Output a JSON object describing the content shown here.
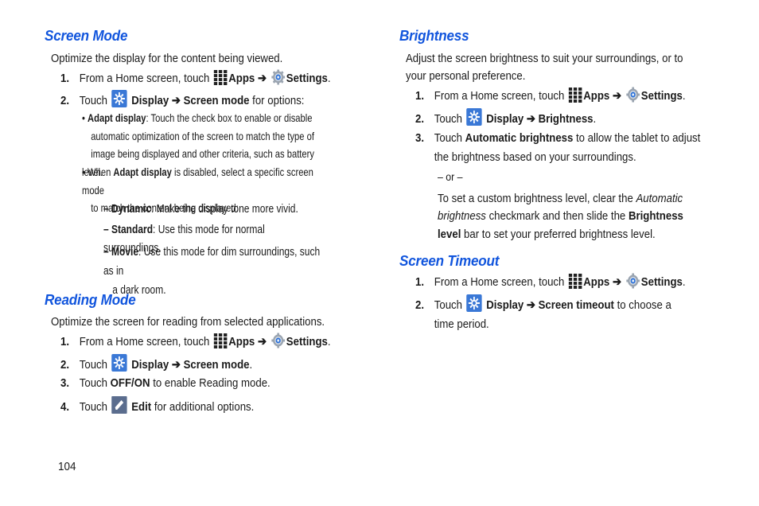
{
  "page_number": "104",
  "arrow": "➔",
  "colors": {
    "heading": "#1155dd",
    "display_icon_bg": "#3a78d6",
    "edit_icon_bg": "#5b6d8e"
  },
  "icons": {
    "apps": "apps-grid-icon",
    "settings": "settings-gear-icon",
    "display": "display-brightness-icon",
    "edit": "edit-pencil-icon"
  },
  "screen_mode": {
    "title": "Screen Mode",
    "intro": "Optimize the display for the content being viewed.",
    "steps": [
      {
        "num": "1.",
        "pre": "From a Home screen, touch",
        "apps": "Apps",
        "settings": "Settings",
        "post": "."
      },
      {
        "num": "2.",
        "pre": "Touch",
        "display": "Display",
        "target": "Screen mode",
        "post": " for options:"
      }
    ],
    "bullets": [
      {
        "bold": "Adapt display",
        "text": ": Touch the check box to enable or disable",
        "lines": [
          "automatic optimization of the screen to match the type of",
          "image being displayed and other criteria, such as battery level."
        ]
      },
      {
        "pre": "When ",
        "bold": "Adapt display",
        "text": " is disabled, select a specific screen mode",
        "lines": [
          "to match the content being displayed:"
        ]
      }
    ],
    "modes": [
      {
        "dash": "–",
        "bold": "Dynamic",
        "text": ": Make the display tone more vivid."
      },
      {
        "dash": "–",
        "bold": "Standard",
        "text": ": Use this mode for normal surroundings."
      },
      {
        "dash": "–",
        "bold": "Movie",
        "text": ": Use this mode for dim surroundings, such as in",
        "line2": "a dark room."
      }
    ]
  },
  "reading_mode": {
    "title": "Reading Mode",
    "intro": "Optimize the screen for reading from selected applications.",
    "steps": [
      {
        "num": "1.",
        "pre": "From a Home screen, touch",
        "apps": "Apps",
        "settings": "Settings",
        "post": "."
      },
      {
        "num": "2.",
        "pre": "Touch",
        "display": "Display",
        "target": "Screen mode",
        "post": "."
      },
      {
        "num": "3.",
        "pre": "Touch ",
        "bold": "OFF/ON",
        "post": " to enable Reading mode."
      },
      {
        "num": "4.",
        "pre": "Touch",
        "bold": "Edit",
        "post": " for additional options."
      }
    ]
  },
  "brightness": {
    "title": "Brightness",
    "intro_line1": "Adjust the screen brightness to suit your surroundings, or to",
    "intro_line2": "your personal preference.",
    "steps": [
      {
        "num": "1.",
        "pre": "From a Home screen, touch",
        "apps": "Apps",
        "settings": "Settings",
        "post": "."
      },
      {
        "num": "2.",
        "pre": "Touch",
        "display": "Display",
        "target": "Brightness",
        "post": "."
      },
      {
        "num": "3.",
        "pre": "Touch ",
        "bold": "Automatic brightness",
        "post": " to allow the tablet to adjust",
        "line2": "the brightness based on your surroundings."
      }
    ],
    "or": "– or –",
    "custom": {
      "l1_pre": "To set a custom brightness level, clear the ",
      "l1_italic": "Automatic",
      "l2_italic": "brightness",
      "l2_mid": " checkmark and then slide the ",
      "l2_bold": "Brightness",
      "l3_bold": "level",
      "l3_post": " bar to set your preferred brightness level."
    }
  },
  "screen_timeout": {
    "title": "Screen Timeout",
    "steps": [
      {
        "num": "1.",
        "pre": "From a Home screen, touch",
        "apps": "Apps",
        "settings": "Settings",
        "post": "."
      },
      {
        "num": "2.",
        "pre": "Touch",
        "display": "Display",
        "target": "Screen timeout",
        "post": " to choose a",
        "line2": "time period."
      }
    ]
  }
}
